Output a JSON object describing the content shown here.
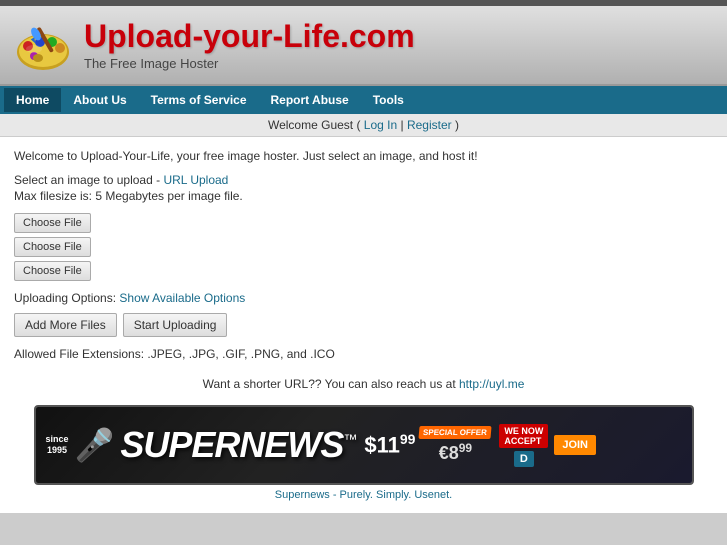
{
  "topbar": {},
  "header": {
    "site_title": "Upload-your-Life.com",
    "site_subtitle": "The Free Image Hoster"
  },
  "nav": {
    "items": [
      {
        "label": "Home",
        "active": true
      },
      {
        "label": "About Us",
        "active": false
      },
      {
        "label": "Terms of Service",
        "active": false
      },
      {
        "label": "Report Abuse",
        "active": false
      },
      {
        "label": "Tools",
        "active": false
      }
    ]
  },
  "welcome_bar": {
    "text": "Welcome Guest ( ",
    "login_label": "Log In",
    "separator": " | ",
    "register_label": "Register",
    "text_end": " )"
  },
  "main": {
    "intro_text": "Welcome to Upload-Your-Life, your free image hoster. Just select an image, and host it!",
    "select_text": "Select an image to upload - ",
    "url_upload_label": "URL Upload",
    "max_filesize_text": "Max filesize is: 5 Megabytes per image file.",
    "file_button_label_1": "Choose File",
    "file_button_label_2": "Choose File",
    "file_button_label_3": "Choose File",
    "uploading_options_label": "Uploading Options: ",
    "show_options_label": "Show Available Options",
    "add_more_files_label": "Add More Files",
    "start_uploading_label": "Start Uploading",
    "allowed_ext_label": "Allowed File Extensions: .JPEG, .JPG, .GIF, .PNG, and .ICO",
    "short_url_text": "Want a shorter URL?? You can also reach us at ",
    "short_url_link": "http://uyl.me"
  },
  "ad": {
    "since_line1": "since",
    "since_line2": "1995",
    "supernews_label": "SUPERNEWS",
    "tm_symbol": "™",
    "price1": "$11",
    "price1_cents": "99",
    "price2": "€8",
    "price2_cents": "99",
    "offer_badge": "SPECIAL OFFER",
    "join_label": "JOIN",
    "link_text": "Supernews - Purely. Simply. Usenet."
  }
}
